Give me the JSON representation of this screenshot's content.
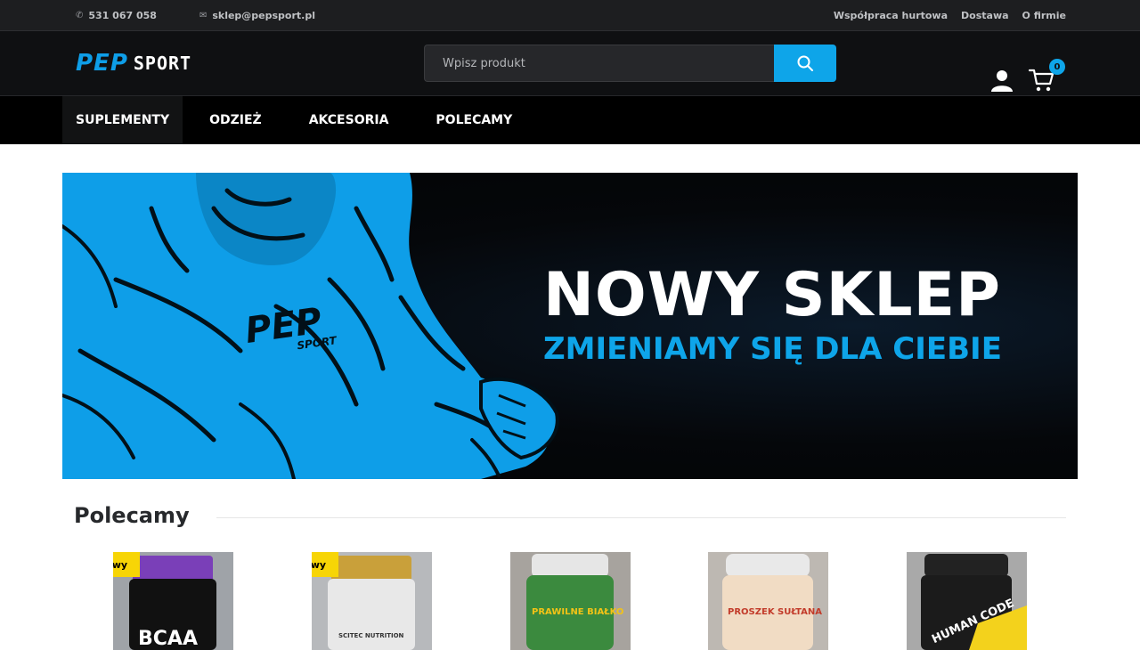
{
  "topbar": {
    "phone": "531 067 058",
    "email": "sklep@pepsport.pl",
    "links": [
      "Współpraca hurtowa",
      "Dostawa",
      "O firmie"
    ]
  },
  "header": {
    "logo": {
      "part1": "PEP",
      "part2": "SPORT"
    },
    "search_placeholder": "Wpisz produkt",
    "cart_count": "0",
    "icons": {
      "search": "search-icon",
      "user": "user-icon",
      "cart": "cart-icon"
    }
  },
  "nav": {
    "items": [
      "SUPLEMENTY",
      "ODZIEŻ",
      "AKCESORIA",
      "POLECAMY"
    ],
    "active": "SUPLEMENTY"
  },
  "banner": {
    "title": "NOWY SKLEP",
    "subtitle": "ZMIENIAMY SIĘ DLA CIEBIE",
    "shirt_logo": "PEP",
    "shirt_logo_sub": "SPORT"
  },
  "recommended": {
    "title": "Polecamy",
    "products": [
      {
        "badge": "Nowy",
        "label": "BCAA",
        "lid": "#7a3fb8",
        "body": "#111111",
        "text_color": "#ffffff"
      },
      {
        "badge": "Nowy",
        "label": "SCITEC NUTRITION",
        "lid": "#c9a03a",
        "body": "#e8e8e8",
        "text_color": "#333333"
      },
      {
        "badge": "",
        "label": "PRAWILNE BIAŁKO",
        "lid": "#e6e6e6",
        "body": "#3b8a3e",
        "text_color": "#f3c316"
      },
      {
        "badge": "",
        "label": "PROSZEK SUŁTANA",
        "lid": "#e9e9e9",
        "body": "#f1dcc4",
        "text_color": "#c23b2a"
      },
      {
        "badge": "",
        "label": "HUMAN CODE",
        "lid": "#222222",
        "body": "#1b1b1b",
        "text_color": "#f3d21c"
      }
    ]
  },
  "colors": {
    "accent": "#0ea5e9",
    "topbar": "#1d1e20",
    "header": "#0f1012",
    "nav": "#000000",
    "badge": "#f7d506"
  }
}
